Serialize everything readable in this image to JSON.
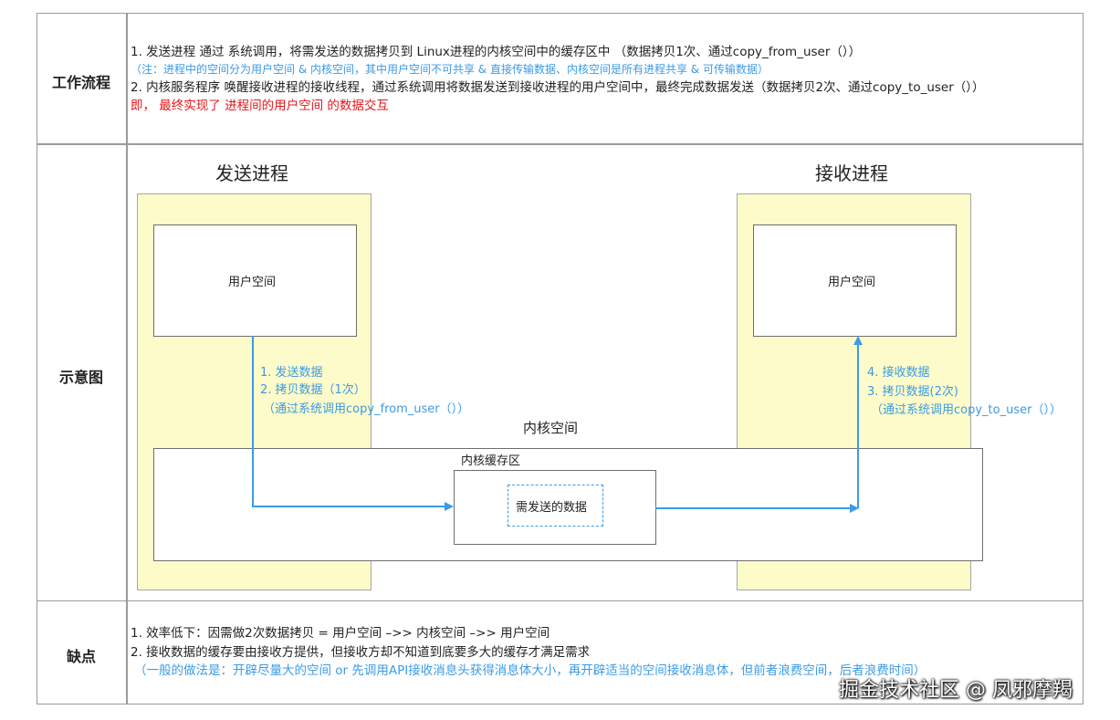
{
  "rows": {
    "workflow": {
      "label": "工作流程",
      "lines": [
        "1. 发送进程 通过 系统调用，将需发送的数据拷贝到 Linux进程的内核空间中的缓存区中 （数据拷贝1次、通过copy_from_user（））",
        "（注：进程中的空间分为用户空间 & 内核空间，其中用户空间不可共享 & 直接传输数据、内核空间是所有进程共享 & 可传输数据）",
        "2. 内核服务程序 唤醒接收进程的接收线程，通过系统调用将数据发送到接收进程的用户空间中，最终完成数据发送（数据拷贝2次、通过copy_to_user（））",
        "即， 最终实现了 进程间的用户空间 的数据交互"
      ]
    },
    "diagram": {
      "label": "示意图",
      "sender_title": "发送进程",
      "receiver_title": "接收进程",
      "sender_user_space": "用户空间",
      "receiver_user_space": "用户空间",
      "kernel_space": "内核空间",
      "kernel_buffer": "内核缓存区",
      "data_to_send": "需发送的数据",
      "send_steps": [
        "1. 发送数据",
        "2. 拷贝数据（1次）",
        "（通过系统调用copy_from_user（））"
      ],
      "recv_steps": [
        "4. 接收数据",
        "3. 拷贝数据(2次)",
        "（通过系统调用copy_to_user（））"
      ]
    },
    "drawbacks": {
      "label": "缺点",
      "lines": [
        "1.  效率低下：因需做2次数据拷贝 = 用户空间 –>> 内核空间 –>> 用户空间",
        "2. 接收数据的缓存要由接收方提供，但接收方却不知道到底要多大的缓存才满足需求",
        "（一般的做法是：开辟尽量大的空间 or 先调用API接收消息头获得消息体大小，再开辟适当的空间接收消息体，但前者浪费空间，后者浪费时间）"
      ]
    }
  },
  "watermark": "掘金技术社区 @ 凤邪摩羯",
  "colors": {
    "blue": "#3b9be6",
    "red": "#e6161b",
    "yellow": "#fdfbc9",
    "border": "#9a9a9a"
  }
}
